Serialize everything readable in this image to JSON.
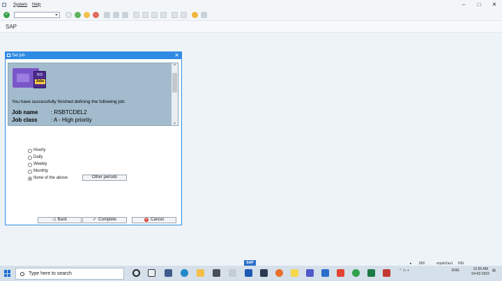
{
  "menu": {
    "items": [
      "System",
      "Help"
    ]
  },
  "title": {
    "text": "SAP"
  },
  "dialog": {
    "title": "Set job",
    "banner": {
      "graphic_r3": "R/3",
      "graphic_jobs": "Jobs",
      "message": "You have successfully finished defining the following job:",
      "job_name_label": "Job name",
      "job_name_value": ": RSBTCDEL2",
      "job_class_label": "Job class",
      "job_class_value": ": A - High priority"
    },
    "options": [
      {
        "label": "Hourly",
        "selected": false
      },
      {
        "label": "Daily",
        "selected": false
      },
      {
        "label": "Weekly",
        "selected": false
      },
      {
        "label": "Monthly",
        "selected": false
      },
      {
        "label": "None of the above",
        "selected": true
      }
    ],
    "other_periods_label": "Other periods",
    "back_label": "Back",
    "complete_label": "Complete",
    "cancel_label": "Cancel"
  },
  "status": {
    "sap_logo": "SAP",
    "zoom": "800",
    "server": "erpde2as1",
    "mode": "INS"
  },
  "taskbar": {
    "search_placeholder": "Type here to search",
    "lang": "ENG",
    "time": "12:55 AM",
    "date": "04-02-2022"
  },
  "colors": {
    "accent": "#2e8ae3",
    "banner": "#a2bccd",
    "ok": "#37a34a"
  }
}
